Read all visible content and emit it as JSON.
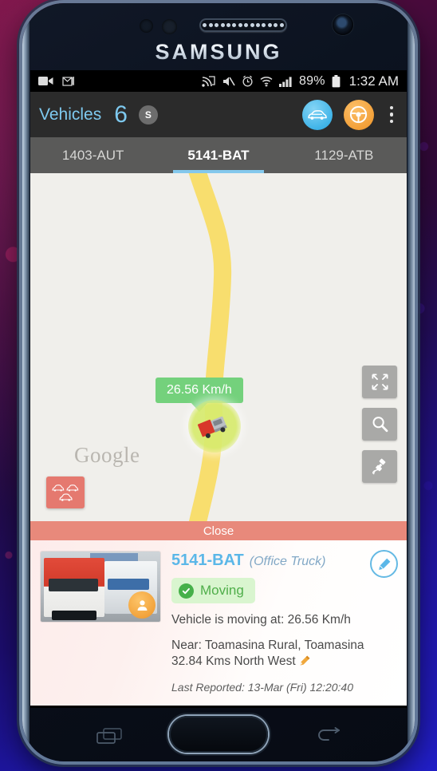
{
  "device": {
    "brand": "SAMSUNG",
    "buttons": {
      "recents": "recents-button",
      "home": "home-button",
      "back": "back-button"
    }
  },
  "status_bar": {
    "left_icons": [
      "video-camera-icon",
      "gmail-icon"
    ],
    "right_icons": [
      "cast-icon",
      "mute-icon",
      "alarm-icon",
      "wifi-icon",
      "signal-icon"
    ],
    "battery": "89%",
    "time": "1:32 AM"
  },
  "app_bar": {
    "title": "Vehicles",
    "count": "6",
    "badge": "S",
    "actions": [
      "car-icon",
      "steering-wheel-icon",
      "overflow-menu-icon"
    ],
    "title_color": "#7ec9ef",
    "bg_color": "#2b2b2b"
  },
  "tabs": [
    {
      "label": "1403-AUT",
      "active": false
    },
    {
      "label": "5141-BAT",
      "active": true
    },
    {
      "label": "1129-ATB",
      "active": false
    }
  ],
  "map": {
    "watermark": "Google",
    "bg_color": "#f0efeb",
    "road_color": "#f8de6e",
    "speed_label": "26.56 Km/h",
    "speed_label_color": "#74d17c",
    "controls": [
      "fullscreen-icon",
      "search-icon",
      "satellite-icon"
    ],
    "nearby_vehicles_color": "#e5796f"
  },
  "close_bar": {
    "label": "Close",
    "color": "#e8897b"
  },
  "info_panel": {
    "vehicle_id": "5141-BAT",
    "vehicle_type": "(Office Truck)",
    "status": "Moving",
    "status_color": "#46b04a",
    "speed_line": "Vehicle is moving at: 26.56 Km/h",
    "near_line": "Near: Toamasina Rural, Toamasina 32.84 Kms North West",
    "last_reported": "Last Reported: 13-Mar (Fri) 12:20:40",
    "edit_icon": "pencil-icon",
    "photo_alt": "vehicle-photo"
  }
}
